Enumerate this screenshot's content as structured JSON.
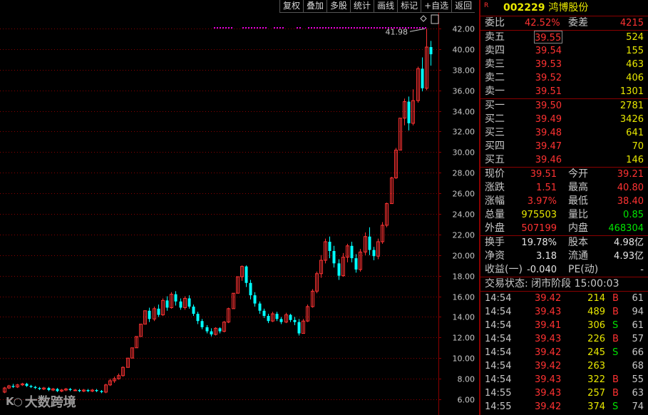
{
  "toolbar": [
    "复权",
    "叠加",
    "多股",
    "统计",
    "画线",
    "标记",
    "+自选",
    "返回"
  ],
  "chart": {
    "y_ticks": [
      "42.00",
      "40.00",
      "38.00",
      "36.00",
      "34.00",
      "32.00",
      "30.00",
      "28.00",
      "26.00",
      "24.00",
      "22.00",
      "20.00",
      "18.00",
      "16.00",
      "14.00",
      "12.00",
      "10.00",
      "8.00",
      "6.00"
    ],
    "max_marker": "41.98",
    "colors": {
      "up": "#ff3232",
      "down": "#00ffff",
      "grid": "#8b0000",
      "dots": "#e000e0"
    }
  },
  "chart_data": {
    "type": "candlestick",
    "ylim": [
      5,
      43
    ],
    "note_max": 41.98,
    "candles": [
      [
        6.7,
        7.1,
        6.6,
        7.2
      ],
      [
        7.1,
        7.3,
        7.0,
        7.4
      ],
      [
        7.3,
        7.2,
        7.1,
        7.5
      ],
      [
        7.2,
        7.4,
        7.1,
        7.5
      ],
      [
        7.4,
        7.5,
        7.3,
        7.6
      ],
      [
        7.5,
        7.3,
        7.2,
        7.6
      ],
      [
        7.3,
        7.2,
        7.1,
        7.4
      ],
      [
        7.2,
        7.1,
        7.0,
        7.3
      ],
      [
        7.1,
        7.0,
        6.9,
        7.2
      ],
      [
        7.0,
        7.1,
        6.9,
        7.2
      ],
      [
        7.1,
        6.9,
        6.8,
        7.2
      ],
      [
        6.9,
        7.0,
        6.8,
        7.1
      ],
      [
        7.0,
        6.8,
        6.7,
        7.1
      ],
      [
        6.8,
        6.9,
        6.7,
        7.0
      ],
      [
        6.9,
        7.0,
        6.8,
        7.1
      ],
      [
        7.0,
        6.9,
        6.8,
        7.1
      ],
      [
        6.9,
        6.9,
        6.8,
        7.0
      ],
      [
        6.9,
        6.8,
        6.7,
        7.0
      ],
      [
        6.8,
        6.9,
        6.7,
        7.0
      ],
      [
        6.9,
        6.8,
        6.7,
        7.0
      ],
      [
        6.8,
        6.9,
        6.7,
        7.0
      ],
      [
        6.9,
        6.8,
        6.7,
        7.0
      ],
      [
        6.8,
        6.7,
        6.6,
        6.9
      ],
      [
        6.7,
        7.4,
        6.6,
        7.5
      ],
      [
        7.4,
        7.8,
        7.3,
        8.0
      ],
      [
        7.8,
        8.0,
        7.6,
        8.2
      ],
      [
        8.0,
        8.3,
        7.9,
        8.5
      ],
      [
        8.3,
        9.1,
        8.2,
        9.2
      ],
      [
        9.1,
        10.0,
        9.1,
        10.0
      ],
      [
        10.0,
        11.0,
        10.0,
        11.0
      ],
      [
        11.0,
        12.1,
        11.0,
        12.1
      ],
      [
        12.1,
        13.3,
        12.1,
        13.3
      ],
      [
        13.3,
        14.6,
        13.3,
        14.6
      ],
      [
        14.6,
        13.8,
        13.5,
        14.9
      ],
      [
        13.8,
        14.8,
        13.6,
        15.0
      ],
      [
        14.8,
        14.2,
        14.0,
        15.2
      ],
      [
        14.2,
        15.6,
        14.1,
        15.8
      ],
      [
        15.6,
        14.9,
        14.6,
        16.0
      ],
      [
        14.9,
        16.2,
        14.8,
        16.4
      ],
      [
        16.2,
        15.5,
        15.1,
        16.5
      ],
      [
        15.5,
        14.9,
        14.7,
        15.8
      ],
      [
        14.9,
        15.8,
        14.7,
        16.0
      ],
      [
        15.8,
        15.0,
        14.8,
        16.1
      ],
      [
        15.0,
        14.3,
        14.1,
        15.2
      ],
      [
        14.3,
        13.6,
        13.3,
        14.5
      ],
      [
        13.6,
        13.0,
        12.8,
        13.8
      ],
      [
        13.0,
        12.6,
        12.4,
        13.2
      ],
      [
        12.6,
        12.3,
        12.1,
        12.9
      ],
      [
        12.3,
        12.9,
        12.2,
        13.0
      ],
      [
        12.9,
        12.6,
        12.4,
        13.0
      ],
      [
        12.6,
        13.5,
        12.5,
        13.6
      ],
      [
        13.5,
        14.8,
        13.4,
        14.9
      ],
      [
        14.8,
        16.3,
        14.8,
        16.3
      ],
      [
        16.3,
        17.9,
        16.3,
        17.9
      ],
      [
        17.9,
        18.9,
        17.5,
        19.0
      ],
      [
        18.9,
        17.3,
        16.9,
        19.0
      ],
      [
        17.3,
        16.1,
        15.7,
        17.6
      ],
      [
        16.1,
        15.3,
        15.0,
        16.4
      ],
      [
        15.3,
        14.6,
        14.3,
        15.5
      ],
      [
        14.6,
        14.1,
        13.9,
        14.8
      ],
      [
        14.1,
        13.6,
        13.4,
        14.3
      ],
      [
        13.6,
        14.3,
        13.5,
        14.5
      ],
      [
        14.3,
        13.8,
        13.6,
        14.5
      ],
      [
        13.8,
        13.5,
        13.3,
        14.0
      ],
      [
        13.5,
        14.2,
        13.4,
        14.4
      ],
      [
        14.2,
        13.7,
        13.5,
        14.3
      ],
      [
        13.7,
        13.5,
        13.2,
        14.0
      ],
      [
        13.5,
        12.4,
        12.2,
        13.8
      ],
      [
        12.4,
        13.6,
        12.4,
        13.8
      ],
      [
        13.6,
        15.0,
        13.5,
        15.2
      ],
      [
        15.0,
        16.5,
        14.9,
        16.7
      ],
      [
        16.5,
        18.2,
        16.3,
        18.4
      ],
      [
        18.2,
        19.5,
        17.8,
        20.0
      ],
      [
        19.5,
        21.3,
        19.2,
        21.6
      ],
      [
        21.3,
        20.4,
        19.7,
        21.8
      ],
      [
        20.4,
        19.2,
        18.8,
        20.9
      ],
      [
        19.2,
        18.0,
        17.6,
        19.6
      ],
      [
        18.0,
        19.8,
        17.9,
        20.2
      ],
      [
        19.8,
        20.9,
        19.3,
        21.1
      ],
      [
        20.9,
        19.7,
        19.3,
        21.3
      ],
      [
        19.7,
        18.6,
        18.3,
        20.1
      ],
      [
        18.6,
        20.3,
        18.4,
        20.6
      ],
      [
        20.3,
        21.8,
        20.0,
        22.2
      ],
      [
        21.8,
        20.5,
        20.0,
        22.7
      ],
      [
        20.5,
        19.9,
        19.5,
        20.8
      ],
      [
        19.9,
        21.3,
        19.6,
        21.6
      ],
      [
        21.3,
        22.9,
        21.1,
        23.2
      ],
      [
        22.9,
        25.0,
        22.7,
        25.1
      ],
      [
        25.0,
        27.5,
        25.0,
        27.6
      ],
      [
        27.5,
        30.2,
        27.4,
        30.4
      ],
      [
        30.2,
        33.3,
        30.2,
        33.3
      ],
      [
        33.3,
        34.9,
        32.6,
        35.2
      ],
      [
        34.9,
        32.8,
        32.1,
        35.4
      ],
      [
        32.8,
        35.0,
        32.6,
        36.1
      ],
      [
        35.0,
        38.1,
        34.8,
        38.3
      ],
      [
        38.1,
        36.2,
        35.9,
        39.2
      ],
      [
        36.2,
        40.2,
        36.0,
        41.98
      ],
      [
        40.2,
        39.5,
        38.4,
        40.8
      ]
    ]
  },
  "panel": {
    "r_mark": "R",
    "code": "002229",
    "name": "鸿博股份",
    "weibi_label": "委比",
    "weibi_value": "42.52%",
    "weicha_label": "委差",
    "weicha_value": "4215",
    "asks": [
      {
        "label": "卖五",
        "price": "39.55",
        "vol": "524"
      },
      {
        "label": "卖四",
        "price": "39.54",
        "vol": "155"
      },
      {
        "label": "卖三",
        "price": "39.53",
        "vol": "463"
      },
      {
        "label": "卖二",
        "price": "39.52",
        "vol": "406"
      },
      {
        "label": "卖一",
        "price": "39.51",
        "vol": "1301"
      }
    ],
    "bids": [
      {
        "label": "买一",
        "price": "39.50",
        "vol": "2781"
      },
      {
        "label": "买二",
        "price": "39.49",
        "vol": "3426"
      },
      {
        "label": "买三",
        "price": "39.48",
        "vol": "641"
      },
      {
        "label": "买四",
        "price": "39.47",
        "vol": "70"
      },
      {
        "label": "买五",
        "price": "39.46",
        "vol": "146"
      }
    ],
    "quote": [
      {
        "l1": "现价",
        "v1": "39.51",
        "c1": "red",
        "l2": "今开",
        "v2": "39.21",
        "c2": "red"
      },
      {
        "l1": "涨跌",
        "v1": "1.51",
        "c1": "red",
        "l2": "最高",
        "v2": "40.80",
        "c2": "red"
      },
      {
        "l1": "涨幅",
        "v1": "3.97%",
        "c1": "red",
        "l2": "最低",
        "v2": "38.40",
        "c2": "red"
      },
      {
        "l1": "总量",
        "v1": "975503",
        "c1": "yellow",
        "l2": "量比",
        "v2": "0.85",
        "c2": "green"
      },
      {
        "l1": "外盘",
        "v1": "507199",
        "c1": "red",
        "l2": "内盘",
        "v2": "468304",
        "c2": "green"
      }
    ],
    "fundamentals": [
      {
        "l1": "换手",
        "v1": "19.78%",
        "l2": "股本",
        "v2": "4.98亿"
      },
      {
        "l1": "净资",
        "v1": "3.18",
        "l2": "流通",
        "v2": "4.93亿"
      },
      {
        "l1": "收益(一)",
        "v1": "-0.040",
        "l2": "PE(动)",
        "v2": "-"
      }
    ],
    "trade_status": "交易状态: 闭市阶段 15:00:03",
    "ticks": [
      {
        "time": "14:54",
        "price": "39.42",
        "vol": "214",
        "side": "B",
        "n": "61"
      },
      {
        "time": "14:54",
        "price": "39.43",
        "vol": "489",
        "side": "B",
        "n": "94"
      },
      {
        "time": "14:54",
        "price": "39.41",
        "vol": "306",
        "side": "S",
        "n": "61"
      },
      {
        "time": "14:54",
        "price": "39.43",
        "vol": "226",
        "side": "B",
        "n": "57"
      },
      {
        "time": "14:54",
        "price": "39.42",
        "vol": "245",
        "side": "S",
        "n": "66"
      },
      {
        "time": "14:54",
        "price": "39.42",
        "vol": "263",
        "side": "",
        "n": "68"
      },
      {
        "time": "14:54",
        "price": "39.43",
        "vol": "322",
        "side": "B",
        "n": "55"
      },
      {
        "time": "14:55",
        "price": "39.43",
        "vol": "257",
        "side": "B",
        "n": "63"
      },
      {
        "time": "14:55",
        "price": "39.42",
        "vol": "374",
        "side": "S",
        "n": "74"
      }
    ]
  },
  "watermark": {
    "logo": "K○",
    "text": "大数跨境"
  }
}
